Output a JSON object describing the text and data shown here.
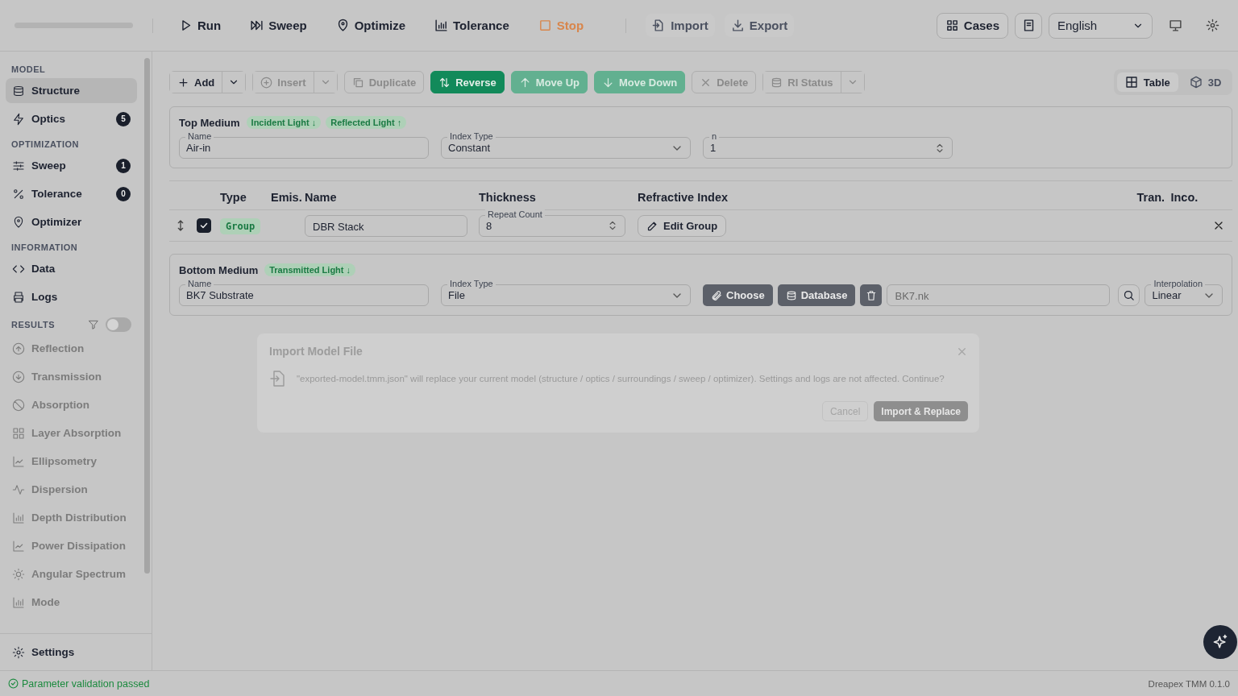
{
  "toolbar": {
    "actions": [
      {
        "label": "Run",
        "kind": "normal"
      },
      {
        "label": "Sweep",
        "kind": "normal"
      },
      {
        "label": "Optimize",
        "kind": "normal"
      },
      {
        "label": "Tolerance",
        "kind": "normal"
      },
      {
        "label": "Stop",
        "kind": "stop"
      }
    ],
    "file_actions": [
      {
        "label": "Import"
      },
      {
        "label": "Export"
      }
    ],
    "cases": "Cases",
    "language": "English"
  },
  "sidebar": {
    "sections": [
      {
        "title": "MODEL",
        "items": [
          {
            "label": "Structure",
            "selected": true
          },
          {
            "label": "Optics",
            "badge": "5",
            "selected": false
          }
        ]
      },
      {
        "title": "OPTIMIZATION",
        "items": [
          {
            "label": "Sweep",
            "badge": "1",
            "selected": false
          },
          {
            "label": "Tolerance",
            "badge": "0",
            "selected": false
          },
          {
            "label": "Optimizer",
            "selected": false
          }
        ]
      },
      {
        "title": "INFORMATION",
        "items": [
          {
            "label": "Data",
            "selected": false
          },
          {
            "label": "Logs",
            "selected": false
          }
        ]
      }
    ],
    "results": {
      "title": "RESULTS",
      "on": false,
      "items": [
        {
          "label": "Reflection",
          "disabled": true
        },
        {
          "label": "Transmission",
          "disabled": true
        },
        {
          "label": "Absorption",
          "disabled": true
        },
        {
          "label": "Layer Absorption",
          "disabled": true
        },
        {
          "label": "Ellipsometry",
          "disabled": true
        },
        {
          "label": "Dispersion",
          "disabled": true
        },
        {
          "label": "Depth Distribution",
          "disabled": true
        },
        {
          "label": "Power Dissipation",
          "disabled": true
        },
        {
          "label": "Angular Spectrum",
          "disabled": true
        },
        {
          "label": "Mode",
          "disabled": true
        }
      ]
    },
    "settings": "Settings"
  },
  "edit_toolbar": {
    "buttons": [
      {
        "label": "Add",
        "kind": "split",
        "disabled": false
      },
      {
        "label": "Insert",
        "kind": "split",
        "disabled": true
      },
      {
        "label": "Duplicate",
        "kind": "plain",
        "disabled": true
      },
      {
        "label": "Reverse",
        "kind": "primary",
        "disabled": false
      },
      {
        "label": "Move Up",
        "kind": "primary",
        "disabled": true
      },
      {
        "label": "Move Down",
        "kind": "primary",
        "disabled": true
      },
      {
        "label": "Delete",
        "kind": "plain",
        "disabled": true
      },
      {
        "label": "RI Status",
        "kind": "split",
        "disabled": true
      }
    ],
    "views": [
      {
        "label": "Table",
        "selected": true
      },
      {
        "label": "3D",
        "selected": false
      }
    ]
  },
  "top_medium": {
    "title": "Top Medium",
    "tags": [
      "Incident Light ↓",
      "Reflected Light ↑"
    ],
    "name": {
      "label": "Name",
      "value": "Air-in"
    },
    "index_type": {
      "label": "Index Type",
      "value": "Constant"
    },
    "n": {
      "label": "n",
      "value": "1"
    }
  },
  "layers": {
    "columns": [
      "Type",
      "Emis.",
      "Name",
      "Thickness",
      "Refractive Index",
      "Tran.",
      "Inco."
    ],
    "rows": [
      {
        "checked": true,
        "type": "Group",
        "name": "DBR Stack",
        "thickness_label": "Repeat Count",
        "thickness": "8",
        "action": "Edit Group"
      }
    ]
  },
  "bottom_medium": {
    "title": "Bottom Medium",
    "tags": [
      "Transmitted Light ↓"
    ],
    "name": {
      "label": "Name",
      "value": "BK7 Substrate"
    },
    "index_type": {
      "label": "Index Type",
      "value": "File"
    },
    "buttons": [
      "Choose",
      "Database"
    ],
    "file": "BK7.nk",
    "interpolation": {
      "label": "Interpolation",
      "value": "Linear"
    }
  },
  "dialog": {
    "title": "Import Model File",
    "message": "\"exported-model.tmm.json\" will replace your current model (structure / optics / surroundings / sweep / optimizer). Settings and logs are not affected. Continue?",
    "cancel": "Cancel",
    "confirm": "Import & Replace"
  },
  "status_bar": {
    "message": "Parameter validation passed",
    "ok": true,
    "version": "Dreapex TMM 0.1.0"
  }
}
